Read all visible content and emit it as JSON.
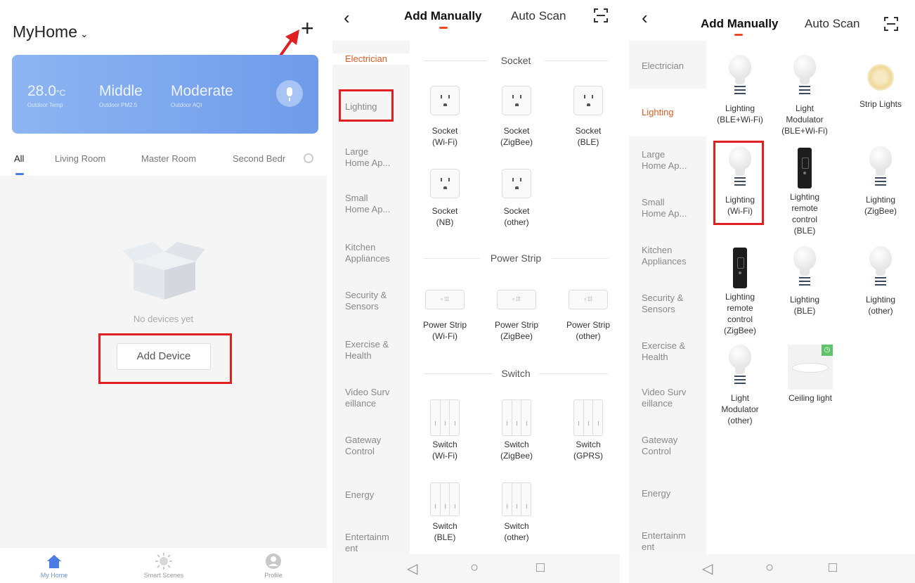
{
  "panel1": {
    "home_title": "MyHome",
    "weather": {
      "temp": "28.0",
      "temp_unit": "°C",
      "temp_label": "Outdoor Temp",
      "pm": "Middle",
      "pm_label": "Outdoor PM2.5",
      "aqi": "Moderate",
      "aqi_label": "Outdoor AQI"
    },
    "rooms": [
      "All",
      "Living Room",
      "Master Room",
      "Second Bedr"
    ],
    "empty_text": "No devices yet",
    "add_device": "Add Device",
    "nav": [
      "My Home",
      "Smart Scenes",
      "Profile"
    ]
  },
  "header": {
    "tab_manual": "Add Manually",
    "tab_scan": "Auto Scan"
  },
  "categories": [
    "Electrician",
    "Lighting",
    "Large\nHome Ap...",
    "Small\nHome Ap...",
    "Kitchen\nAppliances",
    "Security &\nSensors",
    "Exercise &\nHealth",
    "Video Surv\neillance",
    "Gateway\nControl",
    "Energy",
    "Entertainm\nent"
  ],
  "panel2": {
    "sections": {
      "socket": "Socket",
      "power_strip": "Power Strip",
      "switch": "Switch"
    },
    "sockets": [
      "Socket\n(Wi-Fi)",
      "Socket\n(ZigBee)",
      "Socket\n(BLE)",
      "Socket\n(NB)",
      "Socket\n(other)"
    ],
    "strips": [
      "Power Strip\n(Wi-Fi)",
      "Power Strip\n(ZigBee)",
      "Power Strip\n(other)"
    ],
    "switches": [
      "Switch\n(Wi-Fi)",
      "Switch\n(ZigBee)",
      "Switch\n(GPRS)",
      "Switch\n(BLE)",
      "Switch\n(other)"
    ]
  },
  "panel3": {
    "devices": [
      {
        "label": "Lighting\n(BLE+Wi-Fi)",
        "icon": "bulb-icon"
      },
      {
        "label": "Light\nModulator\n(BLE+Wi-Fi)",
        "icon": "bulb-icon"
      },
      {
        "label": "Strip Lights",
        "icon": "strip-light-icon"
      },
      {
        "label": "Lighting\n(Wi-Fi)",
        "icon": "bulb-icon"
      },
      {
        "label": "Lighting\nremote\ncontrol\n(BLE)",
        "icon": "remote-icon"
      },
      {
        "label": "Lighting\n(ZigBee)",
        "icon": "bulb-icon"
      },
      {
        "label": "Lighting\nremote\ncontrol\n(ZigBee)",
        "icon": "remote-icon"
      },
      {
        "label": "Lighting\n(BLE)",
        "icon": "bulb-icon"
      },
      {
        "label": "Lighting\n(other)",
        "icon": "bulb-icon"
      },
      {
        "label": "Light\nModulator\n(other)",
        "icon": "bulb-icon"
      },
      {
        "label": "Ceiling light",
        "icon": "ceiling-light-icon"
      }
    ]
  },
  "colors": {
    "accent": "#e65a23",
    "highlight": "#e02020",
    "weather_card": "#7ea8ef"
  }
}
